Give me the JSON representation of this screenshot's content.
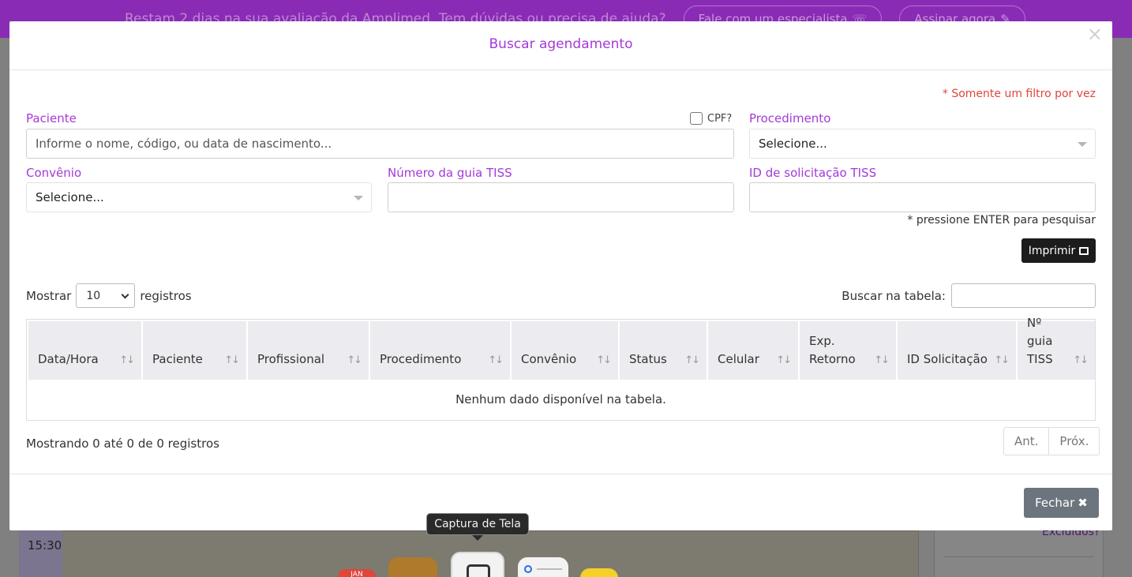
{
  "banner": {
    "text": "Restam 2 dias na sua avaliação da Amplimed. Tem dúvidas ou precisa de ajuda?",
    "talk_button": "Fale com um especialista",
    "subscribe_button": "Assinar agora"
  },
  "background": {
    "time_label": "15:30",
    "excluded_link": "Excluídos?"
  },
  "dock": {
    "calendar_month": "JAN",
    "tooltip": "Captura de Tela"
  },
  "modal": {
    "title": "Buscar agendamento",
    "close_icon": "×",
    "filter_note": "* Somente um filtro por vez",
    "patient": {
      "label": "Paciente",
      "placeholder": "Informe o nome, código, ou data de nascimento...",
      "cpf_label": "CPF?"
    },
    "procedure": {
      "label": "Procedimento",
      "value": "Selecione..."
    },
    "insurance": {
      "label": "Convênio",
      "value": "Selecione..."
    },
    "tiss_guide": {
      "label": "Número da guia TISS",
      "value": ""
    },
    "tiss_request": {
      "label": "ID de solicitação TISS",
      "value": ""
    },
    "enter_note": "* pressione ENTER para pesquisar",
    "print_button": "Imprimir",
    "table": {
      "show_label": "Mostrar",
      "show_value": "10",
      "records_label": "registros",
      "search_label": "Buscar na tabela:",
      "columns": [
        "Data/Hora",
        "Paciente",
        "Profissional",
        "Procedimento",
        "Convênio",
        "Status",
        "Celular",
        "Exp. Retorno",
        "ID Solicitação",
        "Nº guia TISS"
      ],
      "empty_message": "Nenhum dado disponível na tabela.",
      "info": "Mostrando 0 até 0 de 0 registros",
      "prev_label": "Ant.",
      "next_label": "Próx."
    },
    "close_button": "Fechar"
  },
  "colors": {
    "accent_purple": "#a43ad8",
    "banner_purple": "#8a2bb5",
    "note_red": "#e0453d",
    "button_dark": "#1c1c1c",
    "button_gray": "#6c757d"
  }
}
